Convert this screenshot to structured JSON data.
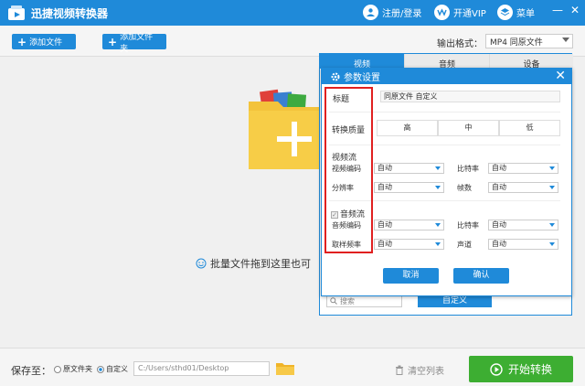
{
  "titlebar": {
    "app_title": "迅捷视频转换器",
    "login": "注册/登录",
    "vip": "开通VIP",
    "menu": "菜单",
    "minimize": "—",
    "close": "✕"
  },
  "toolbar": {
    "add_file": "添加文件",
    "add_folder": "添加文件夹",
    "format_label": "输出格式：",
    "format_value": "MP4  同原文件"
  },
  "main": {
    "drop_text": "批量文件拖到这里也可"
  },
  "bottom": {
    "save_label": "保存至：",
    "opt_source": "原文件夹",
    "opt_custom": "自定义",
    "path": "C:/Users/sthd01/Desktop",
    "clear_list": "清空列表",
    "start": "开始转换"
  },
  "panel": {
    "tabs": [
      "视频",
      "音频",
      "设备"
    ],
    "search_placeholder": "搜索",
    "custom_button": "自定义"
  },
  "dialog": {
    "title": "参数设置",
    "title_label": "标题",
    "title_value": "同原文件 自定义",
    "quality_label": "转换质量",
    "quality_options": [
      "高",
      "中",
      "低"
    ],
    "video_section": "视频流",
    "video_codec_label": "视频编码",
    "video_codec_value": "自动",
    "video_bitrate_label": "比特率",
    "video_bitrate_value": "自动",
    "resolution_label": "分辨率",
    "resolution_value": "自动",
    "fps_label": "帧数",
    "fps_value": "自动",
    "audio_section": "音频流",
    "audio_codec_label": "音频编码",
    "audio_codec_value": "自动",
    "audio_bitrate_label": "比特率",
    "audio_bitrate_value": "自动",
    "sample_rate_label": "取样频率",
    "sample_rate_value": "自动",
    "channel_label": "声道",
    "channel_value": "自动",
    "cancel": "取消",
    "confirm": "确认"
  },
  "colors": {
    "accent": "#1f8ad9",
    "start_green": "#3dae32",
    "highlight_red": "#e02020"
  }
}
